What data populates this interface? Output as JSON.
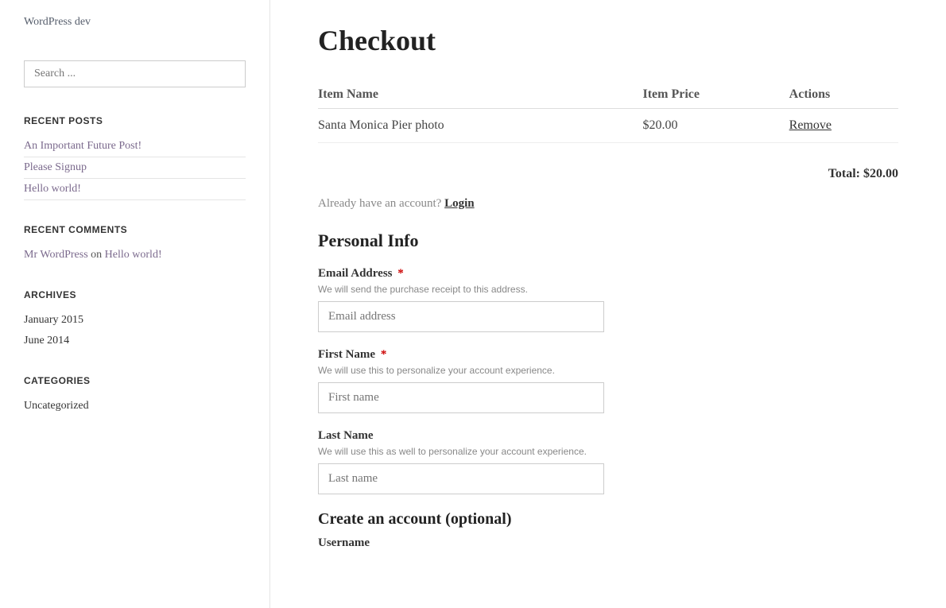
{
  "site": {
    "title": "WordPress dev"
  },
  "sidebar": {
    "search_placeholder": "Search ...",
    "recent_posts_title": "RECENT POSTS",
    "recent_posts": [
      {
        "label": "An Important Future Post!",
        "url": "#"
      },
      {
        "label": "Please Signup",
        "url": "#"
      },
      {
        "label": "Hello world!",
        "url": "#"
      }
    ],
    "recent_comments_title": "RECENT COMMENTS",
    "recent_comments": [
      {
        "author": "Mr WordPress",
        "on": "on",
        "post": "Hello world!",
        "author_url": "#",
        "post_url": "#"
      }
    ],
    "archives_title": "ARCHIVES",
    "archives": [
      {
        "label": "January 2015",
        "url": "#"
      },
      {
        "label": "June 2014",
        "url": "#"
      }
    ],
    "categories_title": "CATEGORIES",
    "categories": [
      {
        "label": "Uncategorized",
        "url": "#"
      }
    ]
  },
  "main": {
    "page_title": "Checkout",
    "table": {
      "col_item_name": "Item Name",
      "col_item_price": "Item Price",
      "col_actions": "Actions",
      "rows": [
        {
          "name": "Santa Monica Pier photo",
          "price": "$20.00",
          "action_label": "Remove"
        }
      ],
      "total_label": "Total: $20.00"
    },
    "account_prompt": "Already have an account?",
    "login_label": "Login",
    "personal_info_title": "Personal Info",
    "fields": {
      "email": {
        "label": "Email Address",
        "required": true,
        "hint": "We will send the purchase receipt to this address.",
        "placeholder": "Email address"
      },
      "first_name": {
        "label": "First Name",
        "required": true,
        "hint": "We will use this to personalize your account experience.",
        "placeholder": "First name"
      },
      "last_name": {
        "label": "Last Name",
        "required": false,
        "hint": "We will use this as well to personalize your account experience.",
        "placeholder": "Last name"
      }
    },
    "create_account_title": "Create an account (optional)",
    "username_label": "Username"
  }
}
